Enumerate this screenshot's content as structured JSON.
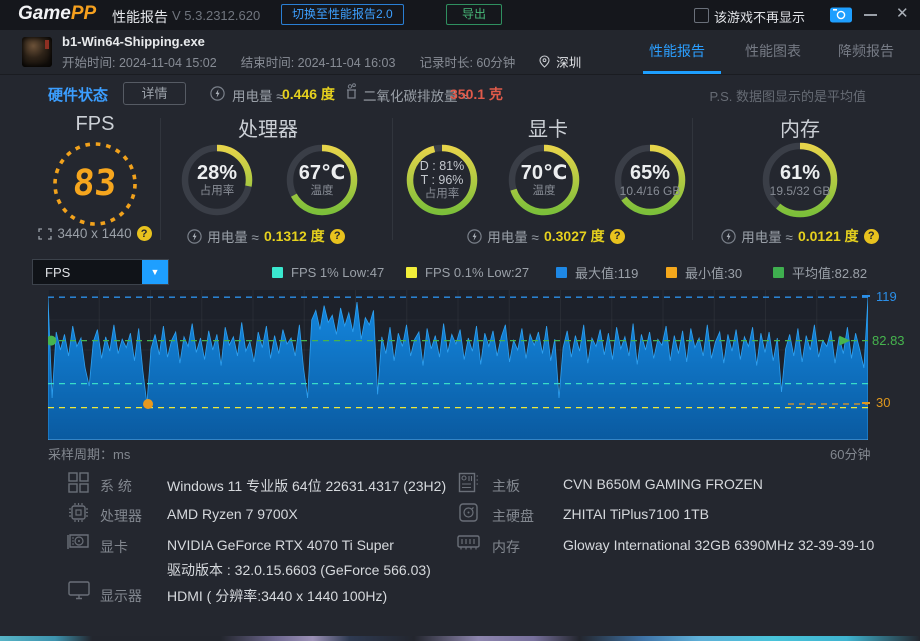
{
  "titlebar": {
    "logo_game": "Game",
    "logo_pp": "PP",
    "title": "性能报告",
    "version": "V 5.3.2312.620",
    "switch_btn": "切换至性能报告2.0",
    "export_btn": "导出",
    "hide_checkbox": "该游戏不再显示"
  },
  "header": {
    "exe": "b1-Win64-Shipping.exe",
    "start": "开始时间: 2024-11-04 15:02",
    "end": "结束时间: 2024-11-04 16:03",
    "duration": "记录时长: 60分钟",
    "city": "深圳",
    "tabs": [
      {
        "label": "性能报告"
      },
      {
        "label": "性能图表"
      },
      {
        "label": "降频报告"
      }
    ]
  },
  "status": {
    "title": "硬件状态",
    "detail_btn": "详情",
    "power_label": "用电量 ≈",
    "power_value": "0.446 度",
    "co2_label": "二氧化碳排放量 ≈",
    "co2_value": "350.1 克",
    "note": "P.S. 数据图显示的是平均值"
  },
  "gauges": {
    "fps": {
      "title": "FPS",
      "value": "83",
      "resolution": "3440 x 1440"
    },
    "cpu": {
      "title": "处理器",
      "usage_pct": 28,
      "usage_text": "28%",
      "usage_label": "占用率",
      "temp_pct": 67,
      "temp_text": "67℃",
      "temp_label": "温度",
      "power_label": "用电量 ≈",
      "power_value": "0.1312 度"
    },
    "gpu": {
      "title": "显卡",
      "usage_pct": 96,
      "d_text": "D : 81%",
      "t_text": "T : 96%",
      "usage_label": "占用率",
      "temp_pct": 70,
      "temp_text": "70℃",
      "temp_label": "温度",
      "vram_pct": 65,
      "vram_text": "65%",
      "vram_detail": "10.4/16 GB",
      "power_label": "用电量 ≈",
      "power_value": "0.3027 度"
    },
    "ram": {
      "title": "内存",
      "pct": 61,
      "pct_text": "61%",
      "detail": "19.5/32 GB",
      "power_label": "用电量 ≈",
      "power_value": "0.0121 度"
    }
  },
  "chart": {
    "dropdown_value": "FPS",
    "legend": [
      {
        "label": "FPS 1% Low:47",
        "color": "#3ae8cf"
      },
      {
        "label": "FPS 0.1% Low:27",
        "color": "#f2ee3a"
      },
      {
        "label": "最大值:119",
        "color": "#1e88e5"
      },
      {
        "label": "最小值:30",
        "color": "#f5a81c"
      },
      {
        "label": "平均值:82.82",
        "color": "#3faf4f"
      }
    ],
    "y_labels": [
      {
        "text": "119",
        "color": "#2b8fe8"
      },
      {
        "text": "82.83",
        "color": "#46b44e"
      },
      {
        "text": "30",
        "color": "#e0981e"
      }
    ],
    "x_left": "采样周期：ms",
    "x_right": "60分钟"
  },
  "chart_data": {
    "type": "area",
    "metric": "FPS",
    "duration_label": "60分钟",
    "ylim": [
      0,
      125
    ],
    "stats": {
      "max": 119,
      "min": 30,
      "avg": 82.82,
      "avg_axis": 82.83,
      "low_1pct": 47,
      "low_01pct": 27
    },
    "series": [
      119,
      35,
      90,
      75,
      88,
      70,
      95,
      78,
      85,
      60,
      45,
      82,
      92,
      68,
      86,
      74,
      96,
      72,
      84,
      77,
      89,
      66,
      93,
      58,
      30,
      76,
      88,
      71,
      95,
      69,
      83,
      90,
      64,
      86,
      78,
      97,
      73,
      85,
      67,
      91,
      75,
      88,
      62,
      94,
      79,
      86,
      70,
      98,
      74,
      82,
      65,
      90,
      77,
      95,
      68,
      87,
      72,
      92,
      80,
      85,
      70,
      96,
      60,
      35,
      100,
      108,
      92,
      112,
      98,
      104,
      88,
      110,
      95,
      106,
      90,
      115,
      84,
      102,
      96,
      108,
      38,
      86,
      72,
      94,
      66,
      89,
      78,
      96,
      70,
      84,
      90,
      62,
      93,
      76,
      87,
      69,
      97,
      73,
      88,
      80,
      92,
      67,
      85,
      74,
      95,
      63,
      89,
      78,
      91,
      70,
      86,
      96,
      65,
      83,
      75,
      93,
      68,
      88,
      79,
      90,
      72,
      95,
      66,
      84,
      35,
      77,
      91,
      69,
      87,
      74,
      96,
      64,
      85,
      78,
      92,
      71,
      89,
      67,
      94,
      76,
      86,
      70,
      97,
      63,
      88,
      75,
      90,
      68,
      84,
      79,
      95,
      66,
      87,
      72,
      91,
      65,
      93,
      77,
      85,
      70,
      96,
      68,
      82,
      90,
      64,
      88,
      74,
      92,
      67,
      86,
      78,
      94,
      62,
      89,
      73,
      90,
      66,
      85,
      40,
      76,
      88,
      70,
      93,
      65,
      87,
      75,
      96,
      69,
      83,
      78,
      91,
      64,
      86,
      72,
      94,
      68,
      89,
      75,
      60,
      119
    ],
    "reference_lines": [
      {
        "value": 119,
        "color": "#2b8fe8",
        "short": false
      },
      {
        "value": 82.83,
        "color": "#46b44e",
        "short": false
      },
      {
        "value": 47,
        "color": "#38dcc8",
        "short": false
      },
      {
        "value": 27,
        "color": "#eee83a",
        "short": false
      },
      {
        "value": 30,
        "color": "#e8981e",
        "short": true
      }
    ],
    "markers": [
      {
        "type": "dot",
        "x_frac": 0.004,
        "value": 82.83,
        "color": "#46b44e"
      },
      {
        "type": "dot",
        "x_frac": 0.122,
        "value": 30,
        "color": "#e8981e"
      },
      {
        "type": "arrow",
        "x_frac": 0.965,
        "value": 82.83,
        "color": "#46b44e"
      }
    ]
  },
  "sysinfo": {
    "left": [
      {
        "label": "系 统",
        "value": "Windows 11 专业版 64位 22631.4317 (23H2)"
      },
      {
        "label": "处理器",
        "value": "AMD Ryzen 7 9700X"
      },
      {
        "label": "显卡",
        "value": "NVIDIA GeForce RTX 4070 Ti Super"
      },
      {
        "label": "显示器",
        "value": "HDMI ( 分辨率:3440 x 1440 100Hz)"
      }
    ],
    "driver": "驱动版本 : 32.0.15.6603 (GeForce 566.03)",
    "right": [
      {
        "label": "主板",
        "value": "CVN B650M GAMING FROZEN"
      },
      {
        "label": "主硬盘",
        "value": "ZHITAI TiPlus7100 1TB"
      },
      {
        "label": "内存",
        "value": "Gloway International 32GB 6390MHz 32-39-39-10"
      }
    ]
  }
}
